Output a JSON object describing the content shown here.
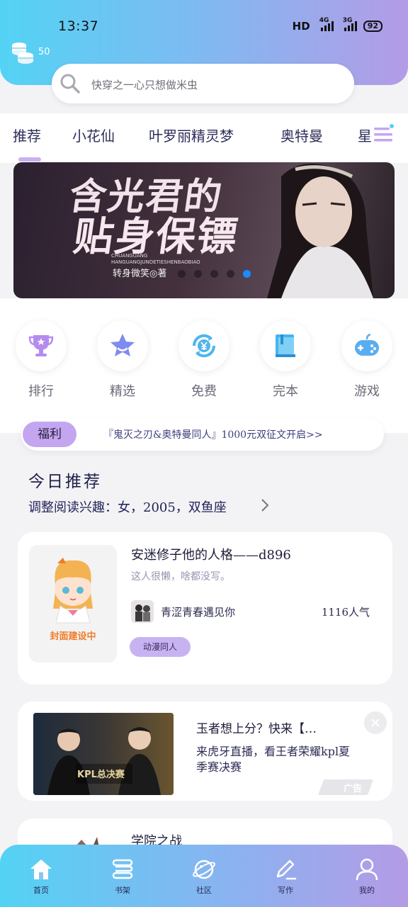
{
  "status_bar": {
    "time": "13:37",
    "hd": "HD",
    "signal1": "4G",
    "signal2": "3G",
    "battery": "92"
  },
  "header": {
    "coin_count": "50",
    "search_placeholder": "快穿之一心只想做米虫"
  },
  "tabs": [
    "推荐",
    "小花仙",
    "叶罗丽精灵梦",
    "奥特曼",
    "星"
  ],
  "banner": {
    "title_line1": "含光君的",
    "title_line2": "贴身保镖",
    "pinyin": "CHUANGUANG\nHANGUANGJUNDETIESHENBAOBIAO",
    "author": "转身微笑◎著"
  },
  "quick_entries": [
    {
      "label": "排行",
      "icon": "trophy-icon"
    },
    {
      "label": "精选",
      "icon": "star-icon"
    },
    {
      "label": "免费",
      "icon": "free-yen-icon"
    },
    {
      "label": "完本",
      "icon": "book-icon"
    },
    {
      "label": "游戏",
      "icon": "gamepad-icon"
    }
  ],
  "welfare": {
    "badge": "福利",
    "text": "『鬼灭之刃&奥特曼同人』1000元双征文开启>>"
  },
  "today": {
    "title": "今日推荐",
    "subtitle": "调整阅读兴趣：女，2005，双鱼座"
  },
  "cards": {
    "book1": {
      "cover_text": "封面建设中",
      "title": "安迷修子他的人格——d896",
      "desc": "这人很懒，啥都没写。",
      "author": "青涩青春遇见你",
      "popularity": "1116人气",
      "tag": "动漫同人"
    },
    "ad": {
      "title": "玉者想上分？快来【…",
      "desc": "来虎牙直播，看王者荣耀kpl夏季赛决赛",
      "mark": "广告",
      "img_caption": "KPL总决赛"
    },
    "book3": {
      "title": "学院之战"
    }
  },
  "bottom_nav": [
    {
      "label": "首页",
      "icon": "home-icon"
    },
    {
      "label": "书架",
      "icon": "bookshelf-icon"
    },
    {
      "label": "社区",
      "icon": "planet-icon"
    },
    {
      "label": "写作",
      "icon": "pen-icon"
    },
    {
      "label": "我的",
      "icon": "user-icon"
    }
  ],
  "colors": {
    "gradient_start": "#53d3f4",
    "gradient_end": "#b49be6",
    "accent_purple": "#c3a6ef",
    "active_dot": "#1a8cff"
  }
}
